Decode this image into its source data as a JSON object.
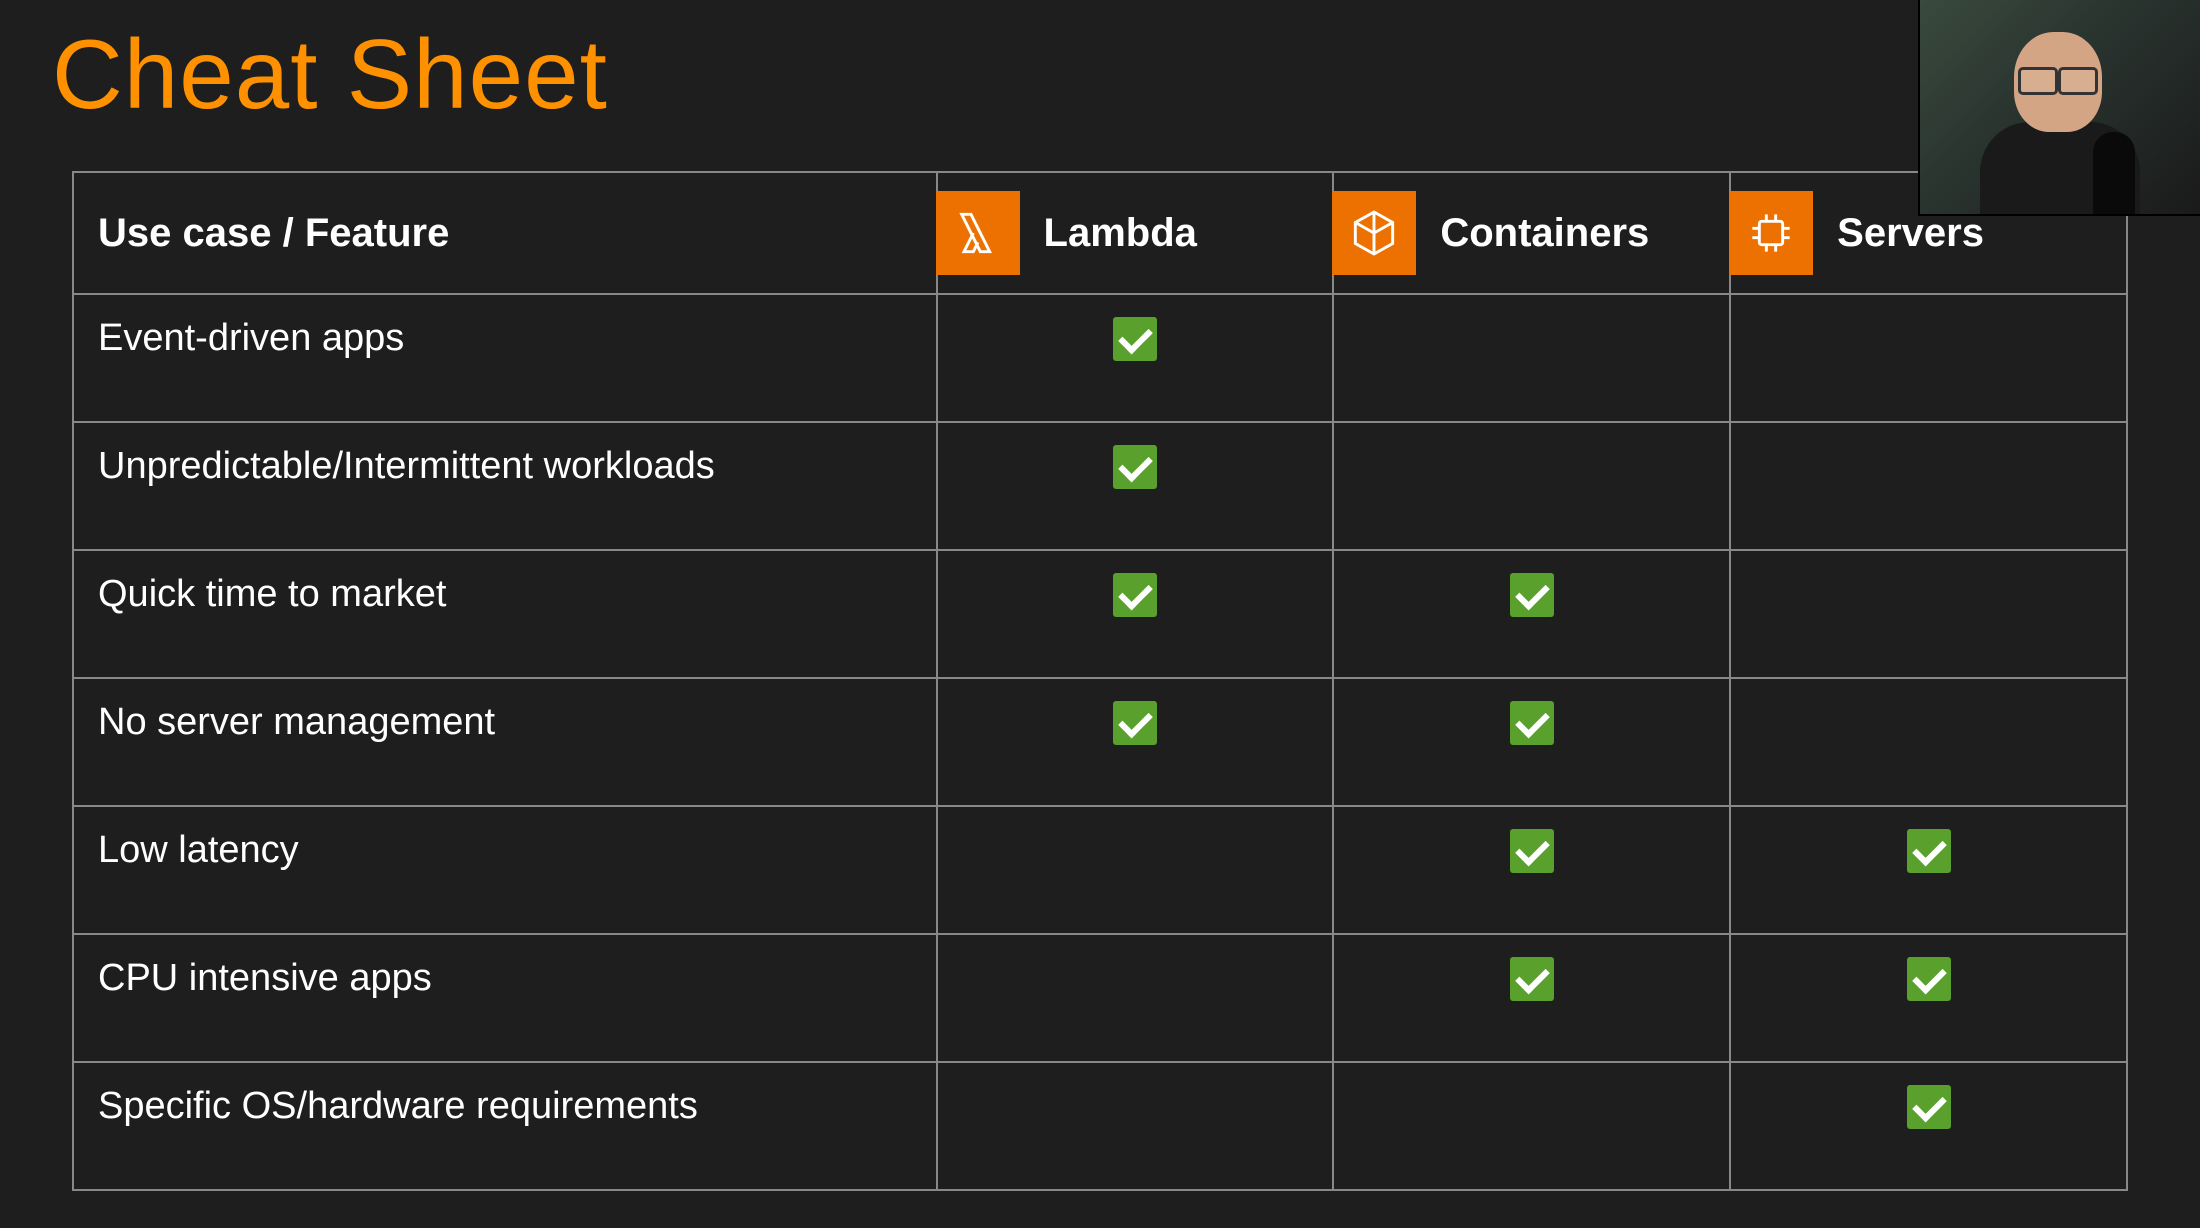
{
  "title": "Cheat Sheet",
  "headers": {
    "feature": "Use case / Feature",
    "lambda": "Lambda",
    "containers": "Containers",
    "servers": "Servers"
  },
  "rows": [
    {
      "feature": "Event-driven apps",
      "lambda": true,
      "containers": false,
      "servers": false
    },
    {
      "feature": "Unpredictable/Intermittent workloads",
      "lambda": true,
      "containers": false,
      "servers": false
    },
    {
      "feature": "Quick time to market",
      "lambda": true,
      "containers": true,
      "servers": false
    },
    {
      "feature": "No server management",
      "lambda": true,
      "containers": true,
      "servers": false
    },
    {
      "feature": "Low latency",
      "lambda": false,
      "containers": true,
      "servers": true
    },
    {
      "feature": "CPU intensive apps",
      "lambda": false,
      "containers": true,
      "servers": true
    },
    {
      "feature": "Specific OS/hardware requirements",
      "lambda": false,
      "containers": false,
      "servers": true
    }
  ],
  "colors": {
    "accent": "#ff9100",
    "iconBg": "#ed7100",
    "check": "#5aa02c"
  }
}
